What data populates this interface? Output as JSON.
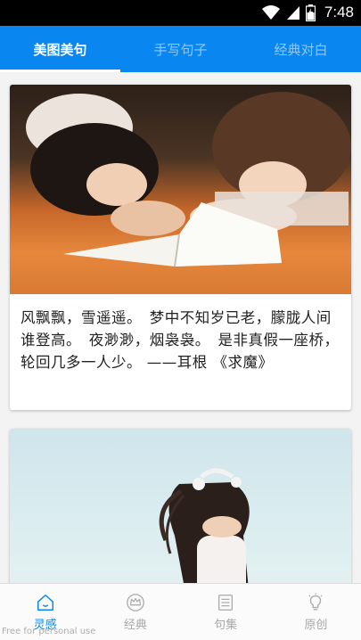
{
  "status_bar": {
    "time": "7:48"
  },
  "top_tabs": [
    {
      "label": "美图美句",
      "active": true
    },
    {
      "label": "手写句子",
      "active": false
    },
    {
      "label": "经典对白",
      "active": false
    }
  ],
  "cards": [
    {
      "text": "风飘飘，雪遥遥。　梦中不知岁已老，朦胧人间谁登高。　夜渺渺，烟袅袅。　是非真假一座桥，轮回几多一人少。 ——耳根 《求魔》"
    }
  ],
  "bottom_nav": [
    {
      "label": "灵感",
      "icon": "home-icon",
      "active": true
    },
    {
      "label": "经典",
      "icon": "crown-icon",
      "active": false
    },
    {
      "label": "句集",
      "icon": "list-icon",
      "active": false
    },
    {
      "label": "原创",
      "icon": "bulb-icon",
      "active": false
    }
  ],
  "watermark": "Free for personal use",
  "colors": {
    "accent": "#0a86f0",
    "status_bar": "#000000"
  }
}
